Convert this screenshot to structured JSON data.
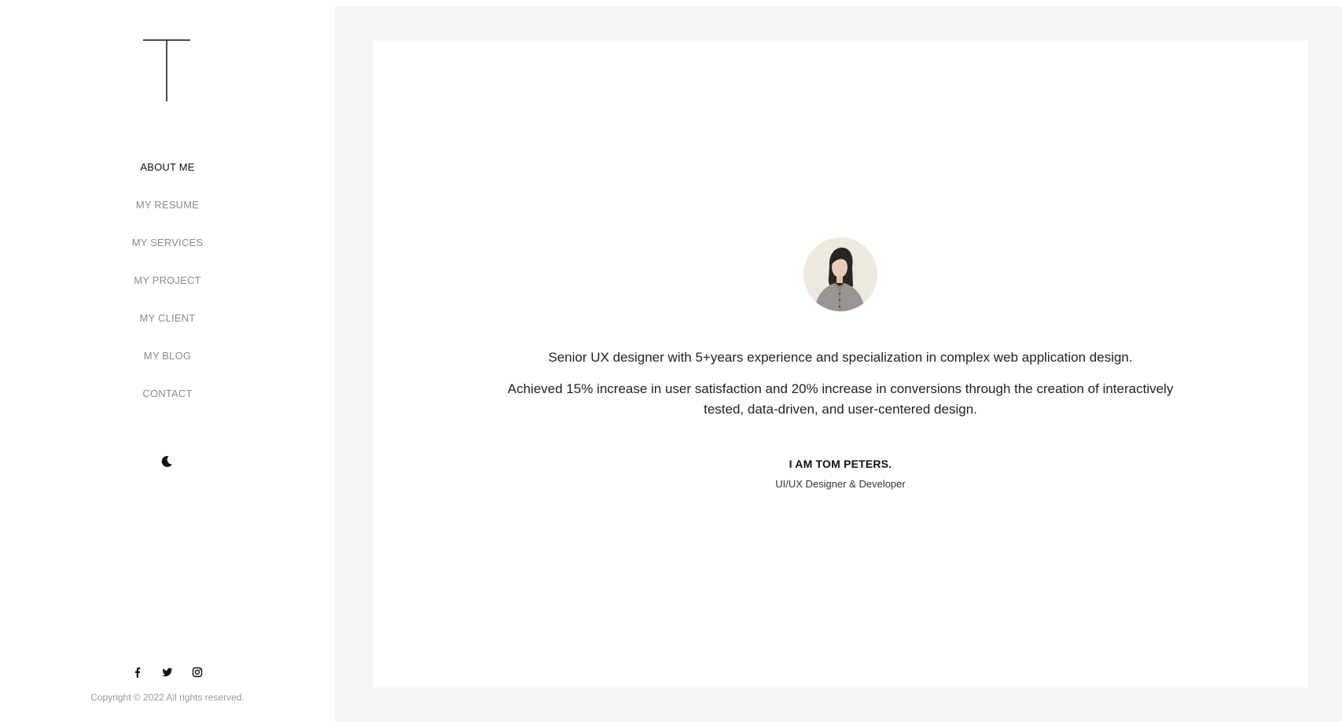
{
  "nav": {
    "items": [
      {
        "label": "ABOUT ME",
        "active": true
      },
      {
        "label": "MY RESUME",
        "active": false
      },
      {
        "label": "MY SERVICES",
        "active": false
      },
      {
        "label": "MY PROJECT",
        "active": false
      },
      {
        "label": "MY CLIENT",
        "active": false
      },
      {
        "label": "MY BLOG",
        "active": false
      },
      {
        "label": "CONTACT",
        "active": false
      }
    ]
  },
  "theme_toggle": {
    "icon": "moon-icon"
  },
  "social": {
    "icons": [
      "facebook-icon",
      "twitter-icon",
      "instagram-icon"
    ]
  },
  "footer": {
    "copyright": "Copyright © 2022 All rights reserved."
  },
  "profile": {
    "avatar_icon": "avatar-photo",
    "intro_line_1": "Senior UX designer with 5+years experience and specialization in complex web application design.",
    "intro_line_2": "Achieved 15% increase in user satisfaction and 20% increase in conversions through the creation of interactively tested, data-driven, and user-centered design.",
    "name": "I AM TOM PETERS.",
    "role": "UI/UX Designer & Developer"
  },
  "colors": {
    "active_nav": "#111111",
    "inactive_nav": "#8a8a8a",
    "main_background": "#f5f5f5",
    "card_background": "#ffffff"
  }
}
